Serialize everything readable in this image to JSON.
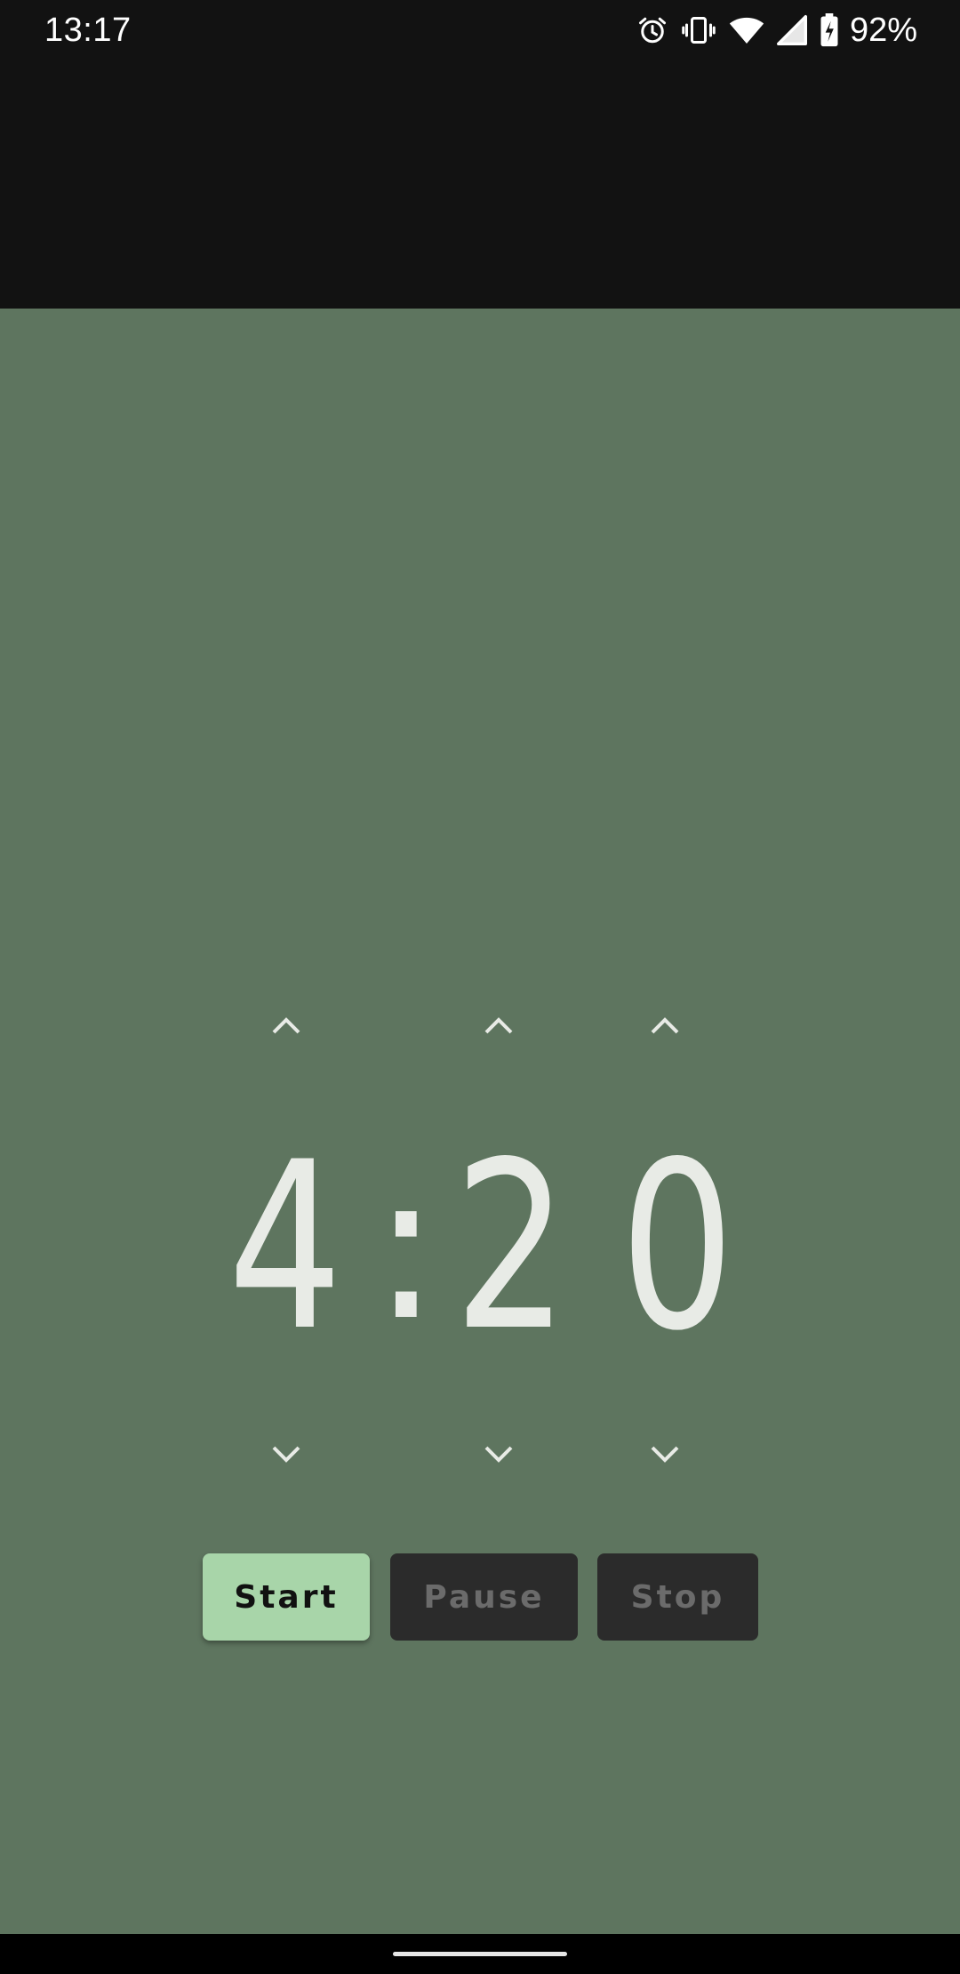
{
  "status_bar": {
    "time": "13:17",
    "battery_percent": "92%",
    "icons": [
      "alarm-icon",
      "vibrate-icon",
      "wifi-icon",
      "signal-icon",
      "battery-charging-icon"
    ]
  },
  "timer": {
    "minutes": "4",
    "separator": ":",
    "seconds_tens": "2",
    "seconds_ones": "0",
    "increment_icon": "chevron-up-icon",
    "decrement_icon": "chevron-down-icon"
  },
  "controls": {
    "start_label": "Start",
    "pause_label": "Pause",
    "stop_label": "Stop"
  },
  "colors": {
    "background": "#5e755f",
    "status_bar": "#121212",
    "start_button": "#a8d5a9",
    "disabled_button": "#2b2b2b",
    "digit_color": "#e8ebe6"
  }
}
